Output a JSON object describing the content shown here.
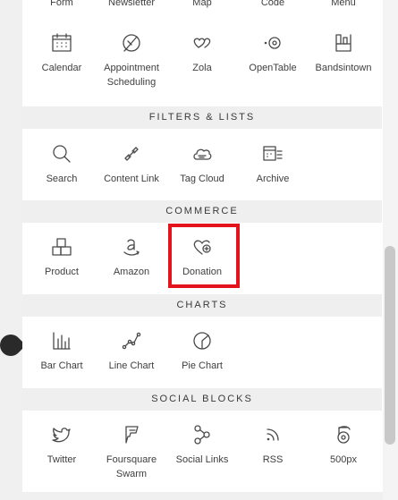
{
  "cutoff_row": [
    "Form",
    "Newsletter",
    "Map",
    "Code",
    "Menu"
  ],
  "rows": {
    "booking": [
      {
        "label": "Calendar",
        "icon": "calendar-icon"
      },
      {
        "label": "Appointment Scheduling",
        "icon": "appointment-icon"
      },
      {
        "label": "Zola",
        "icon": "zola-icon"
      },
      {
        "label": "OpenTable",
        "icon": "opentable-icon"
      },
      {
        "label": "Bandsintown",
        "icon": "bandsintown-icon"
      }
    ]
  },
  "sections": {
    "filters": {
      "title": "FILTERS & LISTS",
      "items": [
        {
          "label": "Search",
          "icon": "search-icon"
        },
        {
          "label": "Content Link",
          "icon": "link-icon"
        },
        {
          "label": "Tag Cloud",
          "icon": "tag-cloud-icon"
        },
        {
          "label": "Archive",
          "icon": "archive-icon"
        }
      ]
    },
    "commerce": {
      "title": "COMMERCE",
      "items": [
        {
          "label": "Product",
          "icon": "product-icon"
        },
        {
          "label": "Amazon",
          "icon": "amazon-icon"
        },
        {
          "label": "Donation",
          "icon": "donation-icon"
        }
      ]
    },
    "charts": {
      "title": "CHARTS",
      "items": [
        {
          "label": "Bar Chart",
          "icon": "bar-chart-icon"
        },
        {
          "label": "Line Chart",
          "icon": "line-chart-icon"
        },
        {
          "label": "Pie Chart",
          "icon": "pie-chart-icon"
        }
      ]
    },
    "social": {
      "title": "SOCIAL BLOCKS",
      "items": [
        {
          "label": "Twitter",
          "icon": "twitter-icon"
        },
        {
          "label": "Foursquare Swarm",
          "icon": "foursquare-icon"
        },
        {
          "label": "Social Links",
          "icon": "social-links-icon"
        },
        {
          "label": "RSS",
          "icon": "rss-icon"
        },
        {
          "label": "500px",
          "icon": "500px-icon"
        }
      ]
    }
  },
  "colors": {
    "highlight": "#e3141b",
    "section_bg": "#efefef",
    "icon_stroke": "#4a4a4a"
  }
}
